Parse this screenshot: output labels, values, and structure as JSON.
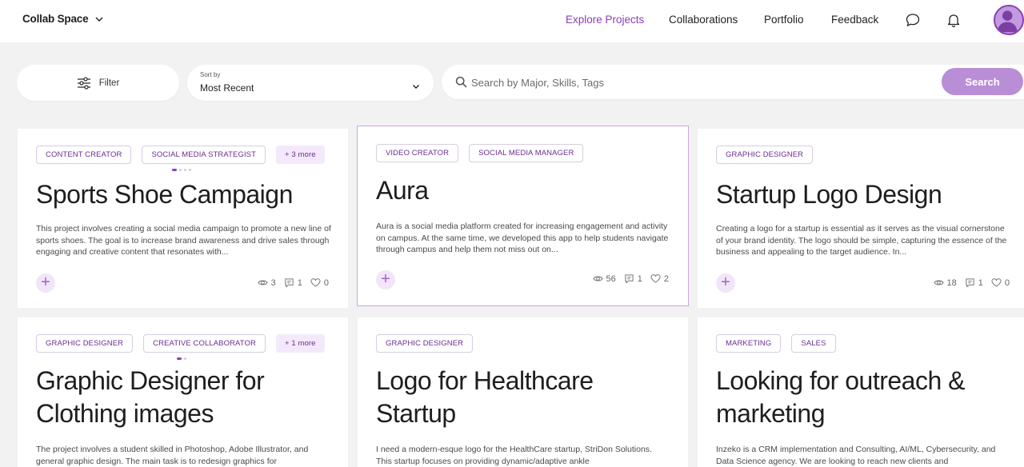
{
  "header": {
    "brand": "Collab Space",
    "nav": [
      {
        "label": "Explore Projects",
        "active": true
      },
      {
        "label": "Collaborations",
        "active": false
      },
      {
        "label": "Portfolio",
        "active": false
      },
      {
        "label": "Feedback",
        "active": false
      }
    ],
    "icons": [
      "chat-bubble-icon",
      "bell-icon",
      "user-avatar"
    ]
  },
  "toolbar": {
    "filter_label": "Filter",
    "sort_caption": "Sort by",
    "sort_value": "Most Recent",
    "search_placeholder": "Search by Major, Skills, Tags",
    "search_button": "Search"
  },
  "colors": {
    "accent": "#8a3fb5",
    "search_button": "#b98ed6",
    "tag_text": "#6a2d94",
    "more_tag_bg": "#f4e9fb"
  },
  "cards": [
    {
      "tags": [
        "CONTENT CREATOR",
        "SOCIAL MEDIA STRATEGIST"
      ],
      "more": "+ 3 more",
      "title": "Sports Shoe Campaign",
      "description": "This project involves creating a social media campaign to promote a new line of sports shoes. The goal is to increase brand awareness and drive sales through engaging and creative content that resonates with...",
      "views": "3",
      "comments": "1",
      "likes": "0"
    },
    {
      "tags": [
        "VIDEO CREATOR",
        "SOCIAL MEDIA MANAGER"
      ],
      "title": "Aura",
      "description": "Aura is a social media platform created for increasing engagement and activity on campus. At the same time, we developed this app to help students navigate through campus and help them not miss out on...",
      "views": "56",
      "comments": "1",
      "likes": "2"
    },
    {
      "tags": [
        "GRAPHIC DESIGNER"
      ],
      "title": "Startup Logo Design",
      "description": "Creating a logo for a startup is essential as it serves as the visual cornerstone of your brand identity. The logo should be simple, capturing the essence of the business and appealing to the target audience. In...",
      "views": "18",
      "comments": "1",
      "likes": "0"
    },
    {
      "tags": [
        "GRAPHIC DESIGNER",
        "CREATIVE COLLABORATOR"
      ],
      "more": "+ 1 more",
      "title": "Graphic Designer for Clothing images",
      "description": "The project involves a student skilled in Photoshop, Adobe Illustrator, and general graphic design. The main task is to redesign graphics for"
    },
    {
      "tags": [
        "GRAPHIC DESIGNER"
      ],
      "title": "Logo for Healthcare Startup",
      "description": "I need a modern-esque logo for the HealthCare startup, StriDon Solutions. This startup focuses on providing dynamic/adaptive ankle"
    },
    {
      "tags": [
        "MARKETING",
        "SALES"
      ],
      "title": "Looking for outreach & marketing",
      "description": "Inzeko is a CRM implementation and Consulting, AI/ML, Cybersecurity, and Data Science agency. We are looking to reach new clients and"
    }
  ]
}
